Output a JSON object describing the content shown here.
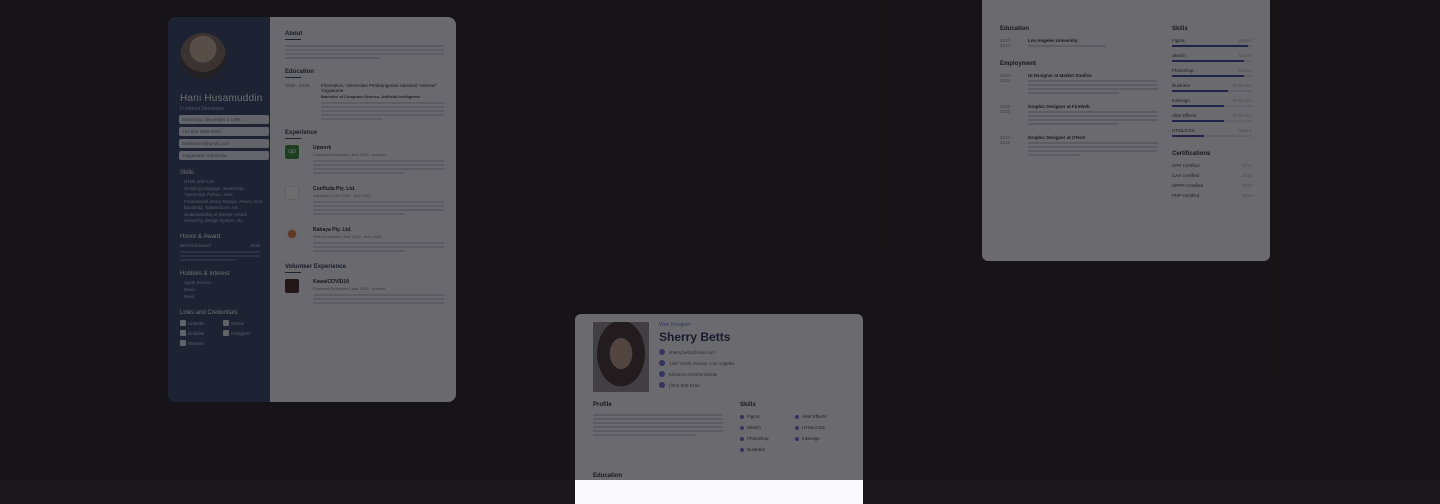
{
  "card1": {
    "name": "Hani Husamuddin",
    "role": "Frontend Developer",
    "fields": [
      "Sukoharjo, December 2 1999",
      "+62 822 3845 9020",
      "hanihusam@gmail.com",
      "Yogyakarta, Indonesia"
    ],
    "skills_title": "Skills",
    "skills": [
      "HTML and CSS",
      "Scripting language: JavaScript, TypeScript, Python, Java",
      "Framework/Library: Django, React, Next, Bootstrap, TailwindCSS, etc.",
      "Understanding of Design: Visual Hierarchy, Design System, etc."
    ],
    "honor_title": "Honor & Award",
    "honor_item": "Best Graduated",
    "honor_year": "2018",
    "hobbies_title": "Hobbies & Interest",
    "hobbies": [
      "Apple Service",
      "Movie",
      "Read"
    ],
    "links_title": "Links and Credentials",
    "links": [
      "LinkedIn",
      "Github",
      "Dribbble",
      "Instagram",
      "Website"
    ],
    "about_title": "About",
    "education_title": "Education",
    "edu_date": "2015 - 2018",
    "edu_school": "Informatics, Universitas Pembangunan Nasional \"Veteran\" Yogyakarta",
    "edu_degree": "Bachelor of Computer Science, Artificial Intelligence",
    "experience_title": "Experience",
    "experiences": [
      {
        "company": "Upwork",
        "meta": "Frontend Developer  |  Nov 2020 - present",
        "logo_color": "#2a8a2f"
      },
      {
        "company": "Cunfluda Pty. Ltd.",
        "meta": "Instagram  |  Oct 2020 - Sep 2021",
        "logo_color": "#ffffff"
      },
      {
        "company": "Rabaya Pty. Ltd.",
        "meta": "Web Developer  |  Mar 2019 - Nov 2019",
        "logo_color": "#f1f1f1"
      }
    ],
    "volunteer_title": "Volunteer Experience",
    "volunteer": {
      "company": "KawalCOVID19",
      "meta": "Frontend Developer  |  Mar 2020 - present"
    }
  },
  "card2": {
    "education_title": "Education",
    "education": {
      "date": "2010 - 2014",
      "title": "Los Angeles University"
    },
    "employment_title": "Employment",
    "jobs": [
      {
        "date": "2020 - 2022",
        "title": "UI Designer at Market Studios"
      },
      {
        "date": "2016 - 2020",
        "title": "Graphic Designer at FireWeb"
      },
      {
        "date": "2014 - 2016",
        "title": "Graphic Designer at STech"
      }
    ],
    "skills_title": "Skills",
    "skills": [
      {
        "name": "Figma",
        "level": "Expert",
        "value": 0.95
      },
      {
        "name": "Sketch",
        "level": "Expert",
        "value": 0.9
      },
      {
        "name": "Photoshop",
        "level": "Expert",
        "value": 0.9
      },
      {
        "name": "Illustrator",
        "level": "Proficient",
        "value": 0.7
      },
      {
        "name": "InDesign",
        "level": "Proficient",
        "value": 0.65
      },
      {
        "name": "After Effects",
        "level": "Proficient",
        "value": 0.65
      },
      {
        "name": "HTML/CSS",
        "level": "Novice",
        "value": 0.4
      }
    ],
    "certs_title": "Certifications",
    "certs": [
      {
        "name": "CPR Certified",
        "year": "2013"
      },
      {
        "name": "CAA Certified",
        "year": "2014"
      },
      {
        "name": "HIPPA Certified",
        "year": "2015"
      },
      {
        "name": "PHP Certified",
        "year": "2016"
      }
    ]
  },
  "card3": {
    "role": "Web Designer",
    "name": "Sherry Betts",
    "contacts": [
      "sherry.betts@mail.com",
      "1257 North Avenue, Los Angeles",
      "behance.net/sherrybetts",
      "(343) 555-5162"
    ],
    "profile_title": "Profile",
    "skills_title": "Skills",
    "skills": [
      "Figma",
      "After Effects",
      "Sketch",
      "HTML/CSS",
      "Photoshop",
      "InDesign",
      "Illustrator"
    ],
    "education_title": "Education"
  }
}
